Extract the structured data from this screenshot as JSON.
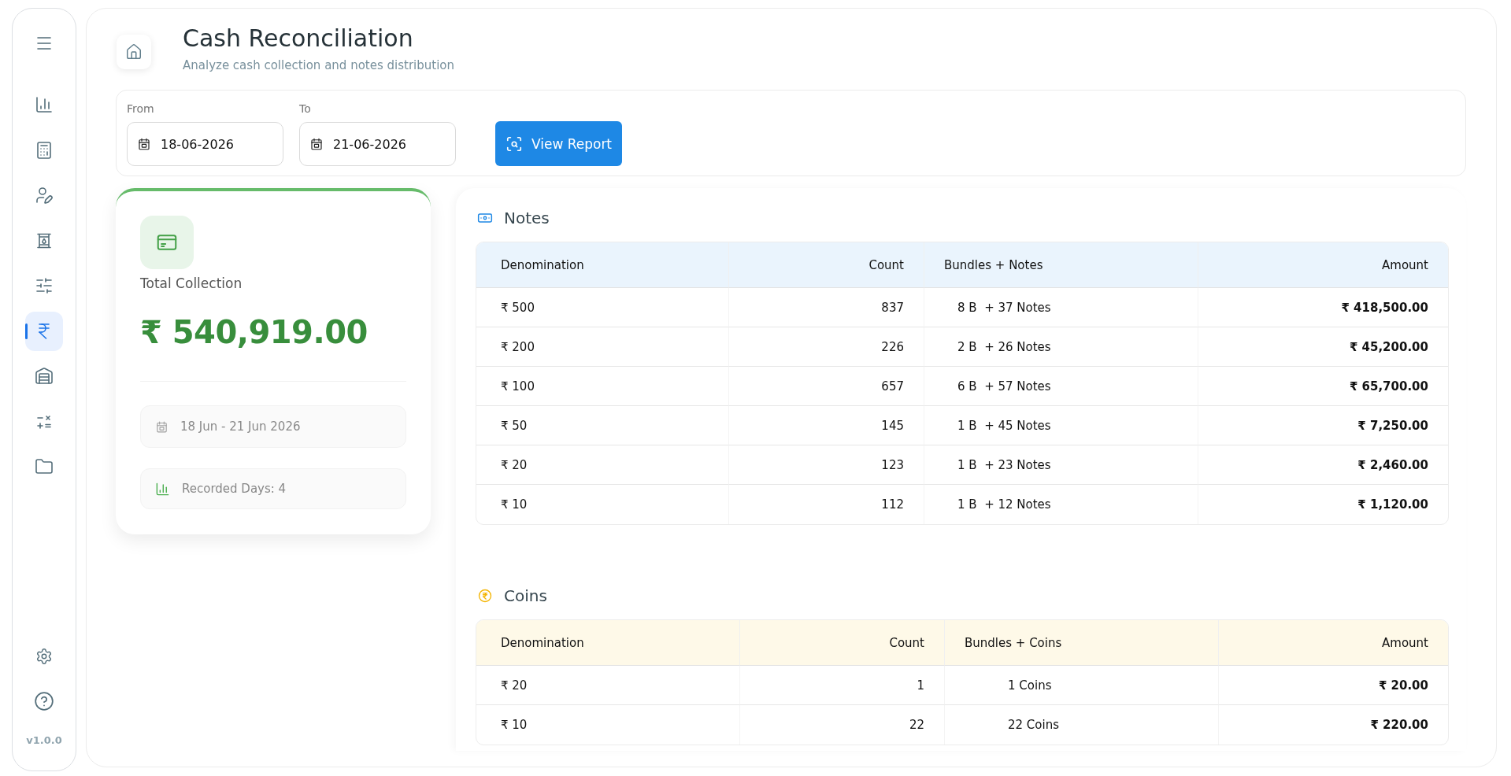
{
  "sidebar": {
    "nav_items": [
      {
        "selected": false
      },
      {
        "selected": false
      },
      {
        "selected": false
      },
      {
        "selected": false
      },
      {
        "selected": false
      },
      {
        "selected": true
      },
      {
        "selected": false
      },
      {
        "selected": false
      },
      {
        "selected": false
      }
    ],
    "version": "v1.0.0"
  },
  "header": {
    "title": "Cash Reconciliation",
    "subtitle": "Analyze cash collection and notes distribution"
  },
  "filters": {
    "fields": [
      {
        "label": "From",
        "value": "18-06-2026"
      },
      {
        "label": "To",
        "value": "21-06-2026"
      }
    ],
    "button": "View Report"
  },
  "summary": {
    "label": "Total Collection",
    "amount": "₹ 540,919.00",
    "date_range": "18 Jun - 21 Jun 2026",
    "recorded_days": "Recorded Days: 4"
  },
  "sections": [
    {
      "kind": "notes",
      "title": "Notes",
      "columns": [
        "Denomination",
        "Count",
        "Bundles + Notes",
        "Amount"
      ],
      "rows": [
        {
          "denomination": "₹ 500",
          "count": "837",
          "bundles": "8 B  + 37 Notes",
          "amount": "₹ 418,500.00"
        },
        {
          "denomination": "₹ 200",
          "count": "226",
          "bundles": "2 B  + 26 Notes",
          "amount": "₹ 45,200.00"
        },
        {
          "denomination": "₹ 100",
          "count": "657",
          "bundles": "6 B  + 57 Notes",
          "amount": "₹ 65,700.00"
        },
        {
          "denomination": "₹ 50",
          "count": "145",
          "bundles": "1 B  + 45 Notes",
          "amount": "₹ 7,250.00"
        },
        {
          "denomination": "₹ 20",
          "count": "123",
          "bundles": "1 B  + 23 Notes",
          "amount": "₹ 2,460.00"
        },
        {
          "denomination": "₹ 10",
          "count": "112",
          "bundles": "1 B  + 12 Notes",
          "amount": "₹ 1,120.00"
        }
      ]
    },
    {
      "kind": "coins",
      "title": "Coins",
      "columns": [
        "Denomination",
        "Count",
        "Bundles + Coins",
        "Amount"
      ],
      "rows": [
        {
          "denomination": "₹ 20",
          "count": "1",
          "bundles": "1 Coins",
          "amount": "₹ 20.00"
        },
        {
          "denomination": "₹ 10",
          "count": "22",
          "bundles": "22 Coins",
          "amount": "₹ 220.00"
        }
      ]
    }
  ]
}
